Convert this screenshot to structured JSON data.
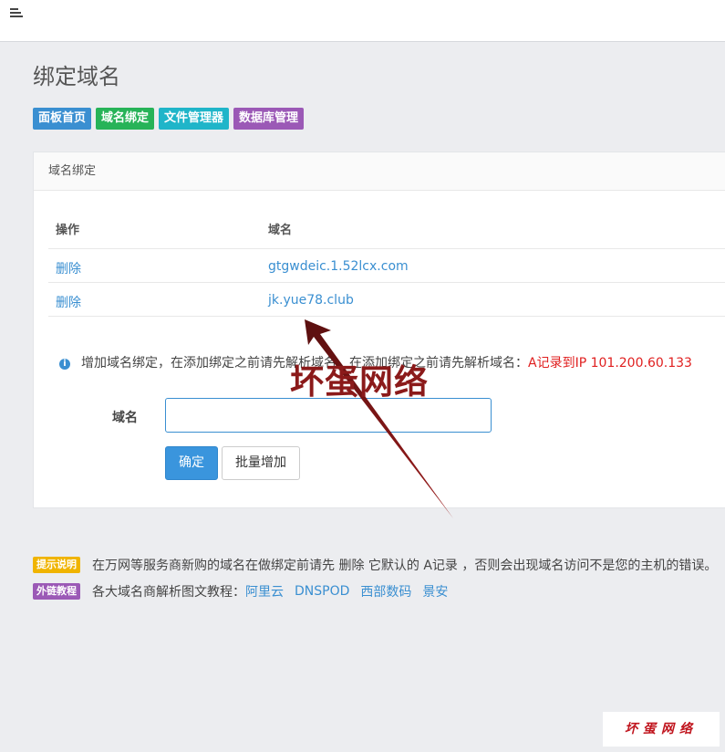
{
  "header": {
    "menu_icon": "hamburger-menu-icon"
  },
  "page": {
    "title": "绑定域名"
  },
  "nav_buttons": [
    {
      "label": "面板首页",
      "color": "#3a8fd1"
    },
    {
      "label": "域名绑定",
      "color": "#27b358"
    },
    {
      "label": "文件管理器",
      "color": "#1fb5c9"
    },
    {
      "label": "数据库管理",
      "color": "#9b59b6"
    }
  ],
  "panel": {
    "title": "域名绑定",
    "table": {
      "headers": [
        "操作",
        "域名"
      ],
      "rows": [
        {
          "action": "删除",
          "domain": "gtgwdeic.1.52lcx.com"
        },
        {
          "action": "删除",
          "domain": "jk.yue78.club"
        }
      ]
    },
    "info": {
      "icon": "info-icon",
      "text": "增加域名绑定，在添加绑定之前请先解析域名，在添加绑定之前请先解析域名：",
      "highlight": "A记录到IP 101.200.60.133"
    },
    "form": {
      "label": "域名",
      "value": "",
      "placeholder": "",
      "ok_label": "确定",
      "bulk_label": "批量增加"
    }
  },
  "watermark_text": "坏蛋网络",
  "notes": {
    "tip_badge": "提示说明",
    "tip_text": "在万网等服务商新购的域名在做绑定前请先 删除 它默认的 A记录 ，否则会出现域名访问不是您的主机的错误。",
    "link_badge": "外链教程",
    "link_text": "各大域名商解析图文教程：",
    "links": [
      "阿里云",
      "DNSPOD",
      "西部数码",
      "景安"
    ]
  },
  "corner_logo": "坏蛋网络",
  "colors": {
    "accent": "#3a8fd1",
    "danger": "#e02020",
    "tip_badge": "#f0b400",
    "link_badge": "#9b59b6"
  }
}
